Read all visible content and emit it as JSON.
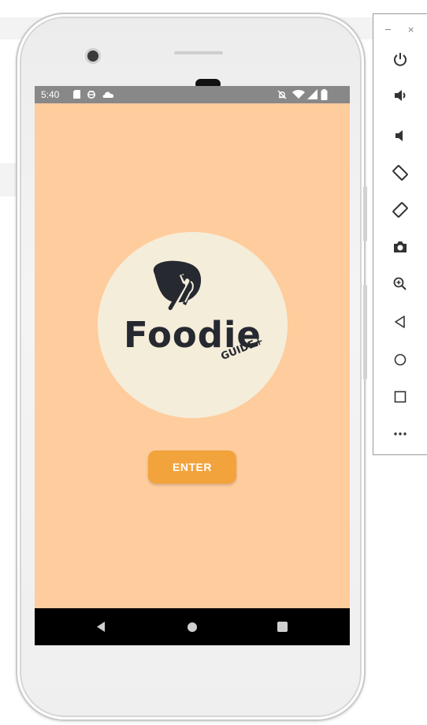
{
  "status_bar": {
    "time": "5:40"
  },
  "app": {
    "logo_title": "Foodie",
    "logo_subtitle": "GUIDE+",
    "enter_label": "ENTER"
  },
  "colors": {
    "screen_background": "#ffcc9d",
    "logo_circle": "#f4edda",
    "enter_button": "#f3a33b",
    "logo_ink": "#262930"
  },
  "emulator_toolbar": {
    "window_controls": [
      "−",
      "×"
    ],
    "buttons": [
      "power-icon",
      "volume-up-icon",
      "volume-down-icon",
      "rotate-left-icon",
      "rotate-right-icon",
      "camera-icon",
      "zoom-in-icon",
      "back-icon",
      "home-icon",
      "overview-icon",
      "more-icon"
    ]
  }
}
